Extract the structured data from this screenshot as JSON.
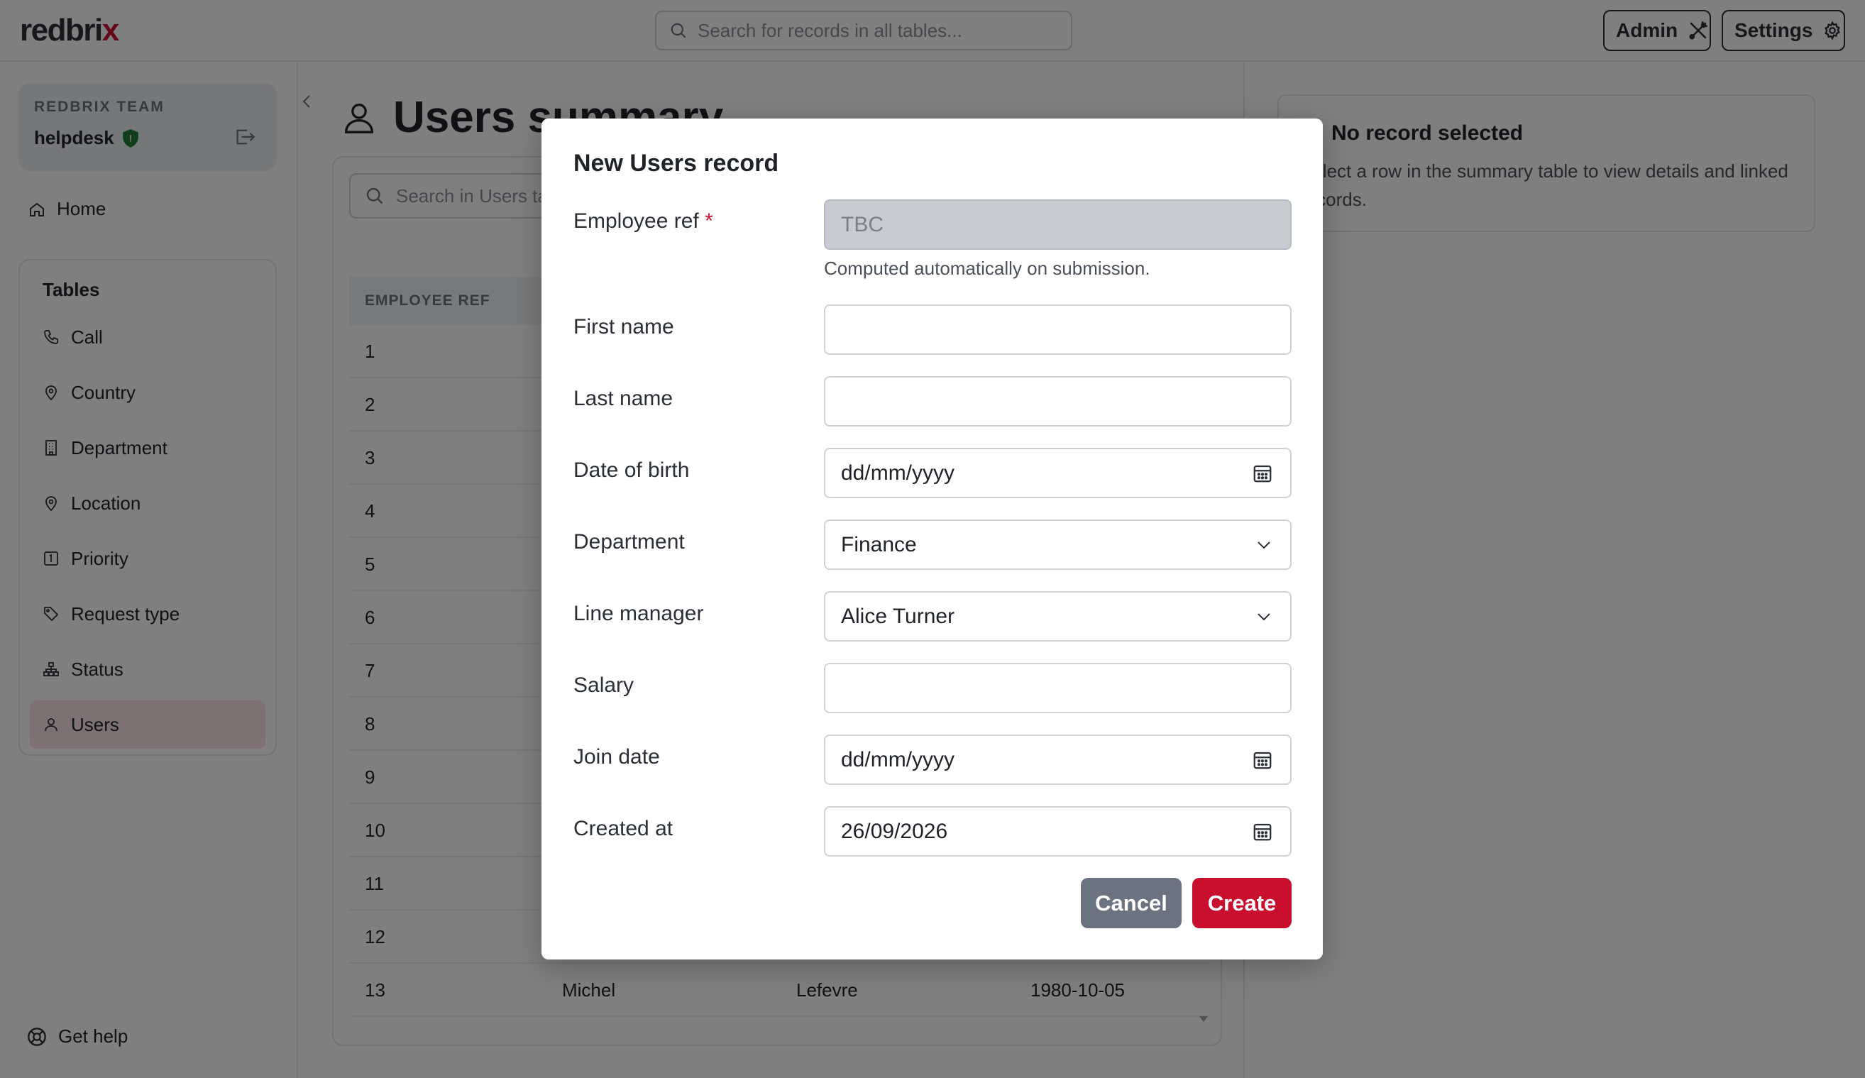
{
  "app": {
    "logo_main": "redbri",
    "logo_accent": "x"
  },
  "topbar": {
    "search_placeholder": "Search for records in all tables...",
    "admin_label": "Admin",
    "settings_label": "Settings"
  },
  "sidebar": {
    "team_label": "REDBRIX TEAM",
    "team_name": "helpdesk",
    "home_label": "Home",
    "tables_title": "Tables",
    "items": [
      {
        "label": "Call",
        "icon": "phone-icon"
      },
      {
        "label": "Country",
        "icon": "map-pin-icon"
      },
      {
        "label": "Department",
        "icon": "building-icon"
      },
      {
        "label": "Location",
        "icon": "map-pin-icon"
      },
      {
        "label": "Priority",
        "icon": "number-one-icon"
      },
      {
        "label": "Request type",
        "icon": "tag-icon"
      },
      {
        "label": "Status",
        "icon": "hierarchy-icon"
      },
      {
        "label": "Users",
        "icon": "user-icon"
      }
    ],
    "active_item": "Users",
    "help_label": "Get help"
  },
  "main": {
    "title": "Users summary",
    "table_search_placeholder": "Search in Users table...",
    "columns": [
      "EMPLOYEE REF"
    ],
    "rows": [
      {
        "ref": "1"
      },
      {
        "ref": "2"
      },
      {
        "ref": "3"
      },
      {
        "ref": "4"
      },
      {
        "ref": "5"
      },
      {
        "ref": "6"
      },
      {
        "ref": "7"
      },
      {
        "ref": "8"
      },
      {
        "ref": "9"
      },
      {
        "ref": "10"
      },
      {
        "ref": "11"
      },
      {
        "ref": "12"
      },
      {
        "ref": "13",
        "first": "Michel",
        "last": "Lefevre",
        "dob": "1980-10-05"
      }
    ]
  },
  "detail": {
    "title": "No record selected",
    "text": "Select a row in the summary table to view details and linked records."
  },
  "modal": {
    "title": "New Users record",
    "fields": {
      "employee_ref": {
        "label": "Employee ref",
        "required_mark": "*",
        "value": "TBC",
        "help": "Computed automatically on submission."
      },
      "first_name": {
        "label": "First name",
        "value": ""
      },
      "last_name": {
        "label": "Last name",
        "value": ""
      },
      "date_of_birth": {
        "label": "Date of birth",
        "value": "dd/mm/yyyy"
      },
      "department": {
        "label": "Department",
        "value": "Finance"
      },
      "line_manager": {
        "label": "Line manager",
        "value": "Alice Turner"
      },
      "salary": {
        "label": "Salary",
        "value": ""
      },
      "join_date": {
        "label": "Join date",
        "value": "dd/mm/yyyy"
      },
      "created_at": {
        "label": "Created at",
        "value": "26/09/2026"
      }
    },
    "cancel_label": "Cancel",
    "create_label": "Create"
  },
  "colors": {
    "accent": "#c8102e",
    "cancel": "#6b7280",
    "active_nav": "#fbe3e6"
  }
}
